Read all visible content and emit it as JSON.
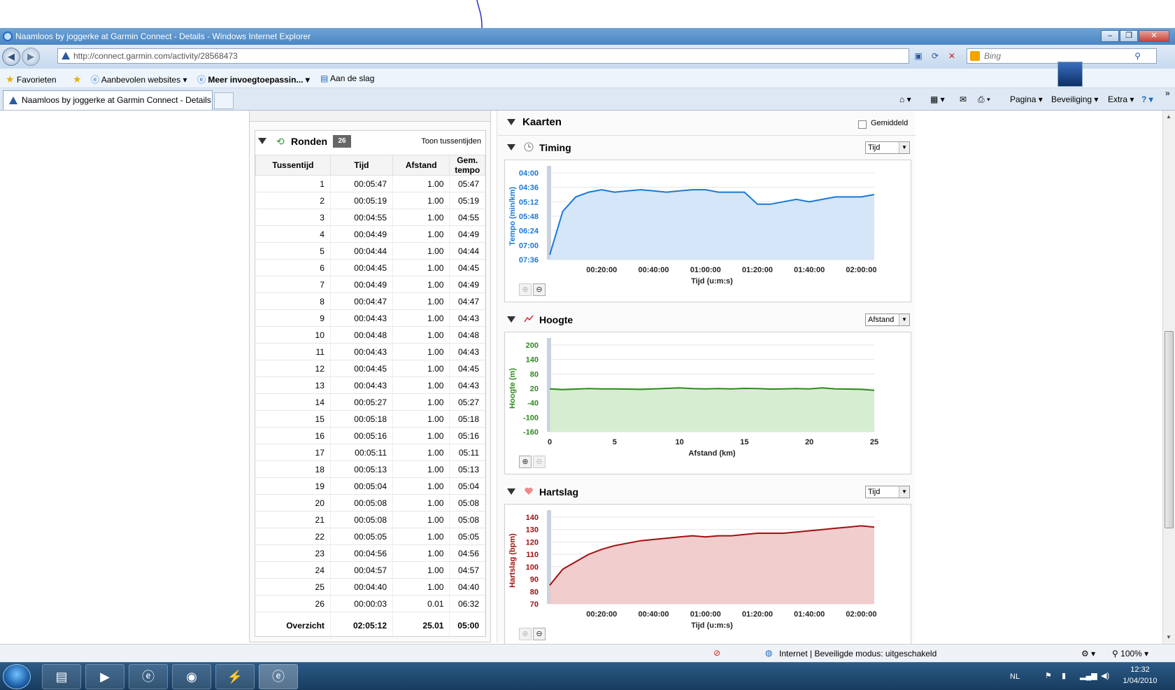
{
  "window": {
    "title": "Naamloos by joggerke at Garmin Connect - Details - Windows Internet Explorer",
    "minimize": "–",
    "maximize": "❐",
    "close": "✕"
  },
  "address": {
    "url": "http://connect.garmin.com/activity/28568473",
    "search_placeholder": "Bing"
  },
  "favorites": {
    "favorites_label": "Favorieten",
    "items": [
      "Aanbevolen websites",
      "Meer invoegtoepassin...",
      "Aan de slag"
    ]
  },
  "tabs": {
    "active": "Naamloos by joggerke at Garmin Connect - Details"
  },
  "commandbar": {
    "page": "Pagina",
    "safety": "Beveiliging",
    "tools": "Extra"
  },
  "laps": {
    "title": "Ronden",
    "count": "26",
    "toggle": "Toon tussentijden",
    "columns": [
      "Tussentijd",
      "Tijd",
      "Afstand",
      "Gem. tempo"
    ],
    "rows": [
      [
        "1",
        "00:05:47",
        "1.00",
        "05:47"
      ],
      [
        "2",
        "00:05:19",
        "1.00",
        "05:19"
      ],
      [
        "3",
        "00:04:55",
        "1.00",
        "04:55"
      ],
      [
        "4",
        "00:04:49",
        "1.00",
        "04:49"
      ],
      [
        "5",
        "00:04:44",
        "1.00",
        "04:44"
      ],
      [
        "6",
        "00:04:45",
        "1.00",
        "04:45"
      ],
      [
        "7",
        "00:04:49",
        "1.00",
        "04:49"
      ],
      [
        "8",
        "00:04:47",
        "1.00",
        "04:47"
      ],
      [
        "9",
        "00:04:43",
        "1.00",
        "04:43"
      ],
      [
        "10",
        "00:04:48",
        "1.00",
        "04:48"
      ],
      [
        "11",
        "00:04:43",
        "1.00",
        "04:43"
      ],
      [
        "12",
        "00:04:45",
        "1.00",
        "04:45"
      ],
      [
        "13",
        "00:04:43",
        "1.00",
        "04:43"
      ],
      [
        "14",
        "00:05:27",
        "1.00",
        "05:27"
      ],
      [
        "15",
        "00:05:18",
        "1.00",
        "05:18"
      ],
      [
        "16",
        "00:05:16",
        "1.00",
        "05:16"
      ],
      [
        "17",
        "00:05:11",
        "1.00",
        "05:11"
      ],
      [
        "18",
        "00:05:13",
        "1.00",
        "05:13"
      ],
      [
        "19",
        "00:05:04",
        "1.00",
        "05:04"
      ],
      [
        "20",
        "00:05:08",
        "1.00",
        "05:08"
      ],
      [
        "21",
        "00:05:08",
        "1.00",
        "05:08"
      ],
      [
        "22",
        "00:05:05",
        "1.00",
        "05:05"
      ],
      [
        "23",
        "00:04:56",
        "1.00",
        "04:56"
      ],
      [
        "24",
        "00:04:57",
        "1.00",
        "04:57"
      ],
      [
        "25",
        "00:04:40",
        "1.00",
        "04:40"
      ],
      [
        "26",
        "00:00:03",
        "0.01",
        "06:32"
      ]
    ],
    "total": [
      "Overzicht",
      "02:05:12",
      "25.01",
      "05:00"
    ]
  },
  "maps": {
    "title": "Kaarten",
    "average_label": "Gemiddeld"
  },
  "charts": {
    "timing": {
      "title": "Timing",
      "select": "Tijd",
      "color": "#1a78d6",
      "fill": "#cfe3f6"
    },
    "altitude": {
      "title": "Hoogte",
      "select": "Afstand",
      "color": "#2f8a1f",
      "fill": "#d3ebcd"
    },
    "heartrate": {
      "title": "Hartslag",
      "select": "Tijd",
      "color": "#a01010",
      "fill": "#f0c8c8"
    }
  },
  "chart_data": [
    {
      "type": "line",
      "title": "Timing",
      "ylabel": "Tempo (min/km)",
      "xlabel": "Tijd (u:m:s)",
      "x_ticks": [
        "00:20:00",
        "00:40:00",
        "01:00:00",
        "01:20:00",
        "01:40:00",
        "02:00:00"
      ],
      "y_ticks": [
        "04:00",
        "04:36",
        "05:12",
        "05:48",
        "06:24",
        "07:00",
        "07:36"
      ],
      "x_unit_minutes": [
        0,
        5,
        10,
        15,
        20,
        25,
        30,
        35,
        40,
        45,
        50,
        55,
        60,
        65,
        70,
        75,
        80,
        85,
        90,
        95,
        100,
        105,
        110,
        115,
        120,
        125
      ],
      "y_pace_minutes": [
        7.4,
        5.6,
        5.0,
        4.8,
        4.7,
        4.8,
        4.75,
        4.7,
        4.75,
        4.8,
        4.75,
        4.7,
        4.7,
        4.8,
        4.8,
        4.8,
        5.3,
        5.3,
        5.2,
        5.1,
        5.2,
        5.1,
        5.0,
        5.0,
        5.0,
        4.9
      ]
    },
    {
      "type": "area",
      "title": "Hoogte",
      "ylabel": "Hoogte (m)",
      "xlabel": "Afstand (km)",
      "x_ticks": [
        "0",
        "5",
        "10",
        "15",
        "20",
        "25"
      ],
      "y_ticks": [
        "200",
        "140",
        "80",
        "20",
        "-40",
        "-100",
        "-160"
      ],
      "x": [
        0,
        1,
        2,
        3,
        4,
        5,
        6,
        7,
        8,
        9,
        10,
        11,
        12,
        13,
        14,
        15,
        16,
        17,
        18,
        19,
        20,
        21,
        22,
        23,
        24,
        25
      ],
      "y": [
        18,
        15,
        17,
        19,
        18,
        18,
        17,
        16,
        18,
        20,
        22,
        19,
        18,
        19,
        18,
        20,
        19,
        17,
        18,
        19,
        18,
        22,
        18,
        17,
        16,
        12
      ]
    },
    {
      "type": "area",
      "title": "Hartslag",
      "ylabel": "Hartslag (bpm)",
      "xlabel": "Tijd (u:m:s)",
      "x_ticks": [
        "00:20:00",
        "00:40:00",
        "01:00:00",
        "01:20:00",
        "01:40:00",
        "02:00:00"
      ],
      "y_ticks": [
        "140",
        "130",
        "120",
        "110",
        "100",
        "90",
        "80",
        "70"
      ],
      "x_minutes": [
        0,
        5,
        10,
        15,
        20,
        25,
        30,
        35,
        40,
        45,
        50,
        55,
        60,
        65,
        70,
        75,
        80,
        85,
        90,
        95,
        100,
        105,
        110,
        115,
        120,
        125
      ],
      "y": [
        85,
        98,
        104,
        110,
        114,
        117,
        119,
        121,
        122,
        123,
        124,
        125,
        124,
        125,
        125,
        126,
        127,
        127,
        127,
        128,
        129,
        130,
        131,
        132,
        133,
        132
      ]
    }
  ],
  "statusbar": {
    "zone": "Internet | Beveiligde modus: uitgeschakeld",
    "zoom": "100%"
  },
  "taskbar": {
    "lang": "NL",
    "time": "12:32",
    "date": "1/04/2010"
  }
}
